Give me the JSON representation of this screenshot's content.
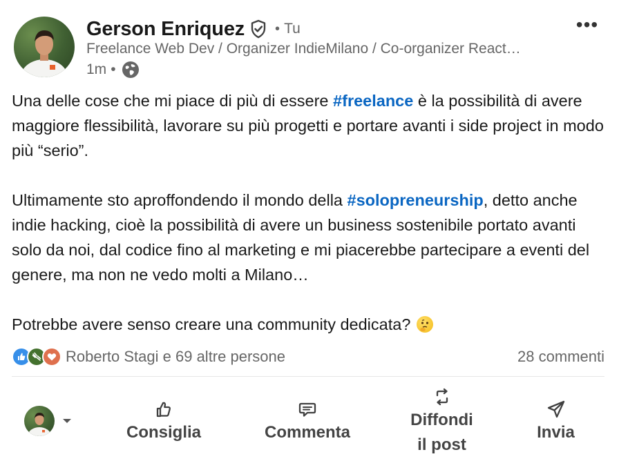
{
  "post": {
    "author": {
      "name": "Gerson Enriquez",
      "relation": "Tu",
      "headline": "Freelance Web Dev / Organizer IndieMilano / Co-organizer React…",
      "time": "1m"
    },
    "body": {
      "p1_a": "Una delle cose che mi piace di più di essere ",
      "p1_tag": "#freelance",
      "p1_b": " è la possibilità di avere maggiore flessibilità, lavorare su più progetti e portare avanti i side project in modo più “serio”.",
      "p2_a": "Ultimamente sto aproffondendo il mondo della ",
      "p2_tag": "#solopreneurship",
      "p2_b": ", detto anche indie hacking, cioè la possibilità di avere un business sostenibile portato avanti solo da noi, dal codice fino al marketing e mi piacerebbe partecipare a eventi del genere, ma non ne vedo molti a Milano…",
      "p3": "Potrebbe avere senso creare una community dedicata? "
    },
    "social": {
      "reactions": [
        "like-icon",
        "celebrate-icon",
        "love-icon"
      ],
      "reactors": "Roberto Stagi e 69 altre persone",
      "comments": "28 commenti"
    },
    "actions": {
      "like": "Consiglia",
      "comment": "Commenta",
      "share_line1": "Diffondi",
      "share_line2": "il post",
      "send": "Invia"
    }
  },
  "colors": {
    "hashtag": "#0a66c2",
    "secondary_text": "#666666",
    "like_reaction": "#378fe9",
    "celebrate_reaction": "#44712e",
    "love_reaction": "#df704d"
  }
}
